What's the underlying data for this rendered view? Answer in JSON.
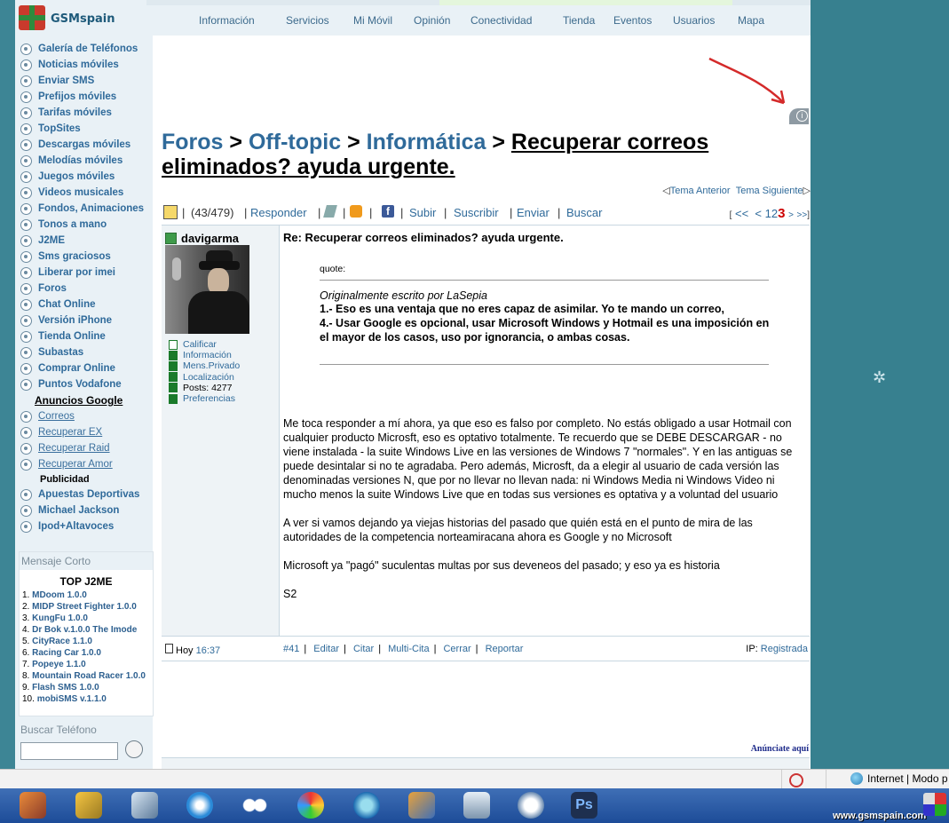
{
  "brand": {
    "name": "GSMspain"
  },
  "topnav": [
    "Información",
    "Servicios",
    "Mi Móvil",
    "Opinión",
    "Conectividad",
    "Tienda",
    "Eventos",
    "Usuarios",
    "Mapa"
  ],
  "sidebar": {
    "items": [
      "Galería de Teléfonos",
      "Noticias móviles",
      "Enviar SMS",
      "Prefijos móviles",
      "Tarifas móviles",
      "TopSites",
      "Descargas móviles",
      "Melodías móviles",
      "Juegos móviles",
      "Videos musicales",
      "Fondos, Animaciones",
      "Tonos a mano",
      "J2ME",
      "Sms graciosos",
      "Liberar por imei",
      "Foros",
      "Chat Online",
      "Versión iPhone",
      "Tienda Online",
      "Subastas",
      "Comprar Online",
      "Puntos Vodafone"
    ],
    "ads_heading": "Anuncios Google",
    "ads": [
      "Correos",
      "Recuperar EX",
      "Recuperar Raid",
      "Recuperar Amor"
    ],
    "publicidad": "Publicidad",
    "extra": [
      "Apuestas Deportivas",
      "Michael Jackson",
      "Ipod+Altavoces"
    ],
    "mensaje_corto": "Mensaje Corto",
    "top_title": "TOP J2ME",
    "top_list": [
      "MDoom 1.0.0",
      "MIDP Street Fighter 1.0.0",
      "KungFu 1.0.0",
      "Dr Bok v.1.0.0 The Imode",
      "CityRace 1.1.0",
      "Racing Car 1.0.0",
      "Popeye 1.1.0",
      "Mountain Road Racer 1.0.0",
      "Flash SMS 1.0.0",
      "mobiSMS v.1.1.0"
    ],
    "buscar_telefono": "Buscar Teléfono"
  },
  "breadcrumb": {
    "foros": "Foros",
    "offtopic": "Off-topic",
    "informatica": "Informática",
    "thread": "Recuperar correos eliminados? ayuda urgente.",
    "sep": ">"
  },
  "theme_nav": {
    "prev": "Tema Anterior",
    "next": "Tema Siguiente"
  },
  "toolbar": {
    "count": "(43/479)",
    "responder": "Responder",
    "subir": "Subir",
    "suscribir": "Suscribir",
    "enviar": "Enviar",
    "buscar": "Buscar"
  },
  "pager": {
    "first": "<<",
    "prev": "<",
    "p1": "1",
    "p2": "2",
    "p3": "3",
    "next": ">",
    "last": ">>"
  },
  "post": {
    "author": "davigarma",
    "user_menu": [
      "Calificar",
      "Información",
      "Mens.Privado",
      "Localización",
      "Posts: 4277",
      "Preferencias"
    ],
    "title": "Re: Recuperar correos eliminados? ayuda urgente.",
    "quote_label": "quote:",
    "quote_author": "Originalmente escrito por LaSepia",
    "quote_text": "1.- Eso es una ventaja que no eres capaz de asimilar. Yo te mando un correo,\n4.- Usar Google es opcional, usar Microsoft Windows y Hotmail es una imposición en el mayor de los casos, uso por ignorancia, o ambas cosas.",
    "body": [
      "Me toca responder a mí ahora, ya que eso es falso por completo. No estás obligado a usar Hotmail con cualquier producto Microsft, eso es optativo totalmente. Te recuerdo que se DEBE DESCARGAR - no viene instalada - la suite Windows Live en las versiones de Windows 7 \"normales\". Y en las antiguas se puede desintalar si no te agradaba. Pero además, Microsft, da a elegir al usuario de cada versión las denominadas versiones N, que por no llevar no llevan nada: ni Windows Media ni Windows Video ni mucho menos la suite Windows Live que en todas sus versiones es optativa y a voluntad del usuario",
      "A ver si vamos dejando ya viejas historias del pasado que quién está en el punto de mira de las autoridades de la competencia norteamiracana ahora es Google y no Microsoft",
      "Microsoft ya \"pagó\" suculentas multas por sus deveneos del pasado; y eso ya es historia",
      "S2"
    ],
    "date_label": "Hoy",
    "time": "16:37",
    "number": "#41",
    "actions": [
      "Editar",
      "Citar",
      "Multi-Cita",
      "Cerrar",
      "Reportar"
    ],
    "ip_label": "IP:",
    "ip_value": "Registrada"
  },
  "anunciese": "Anúnciate aquí",
  "statusbar": {
    "zone": "Internet | Modo p"
  },
  "watermark": "www.gsmspain.com"
}
